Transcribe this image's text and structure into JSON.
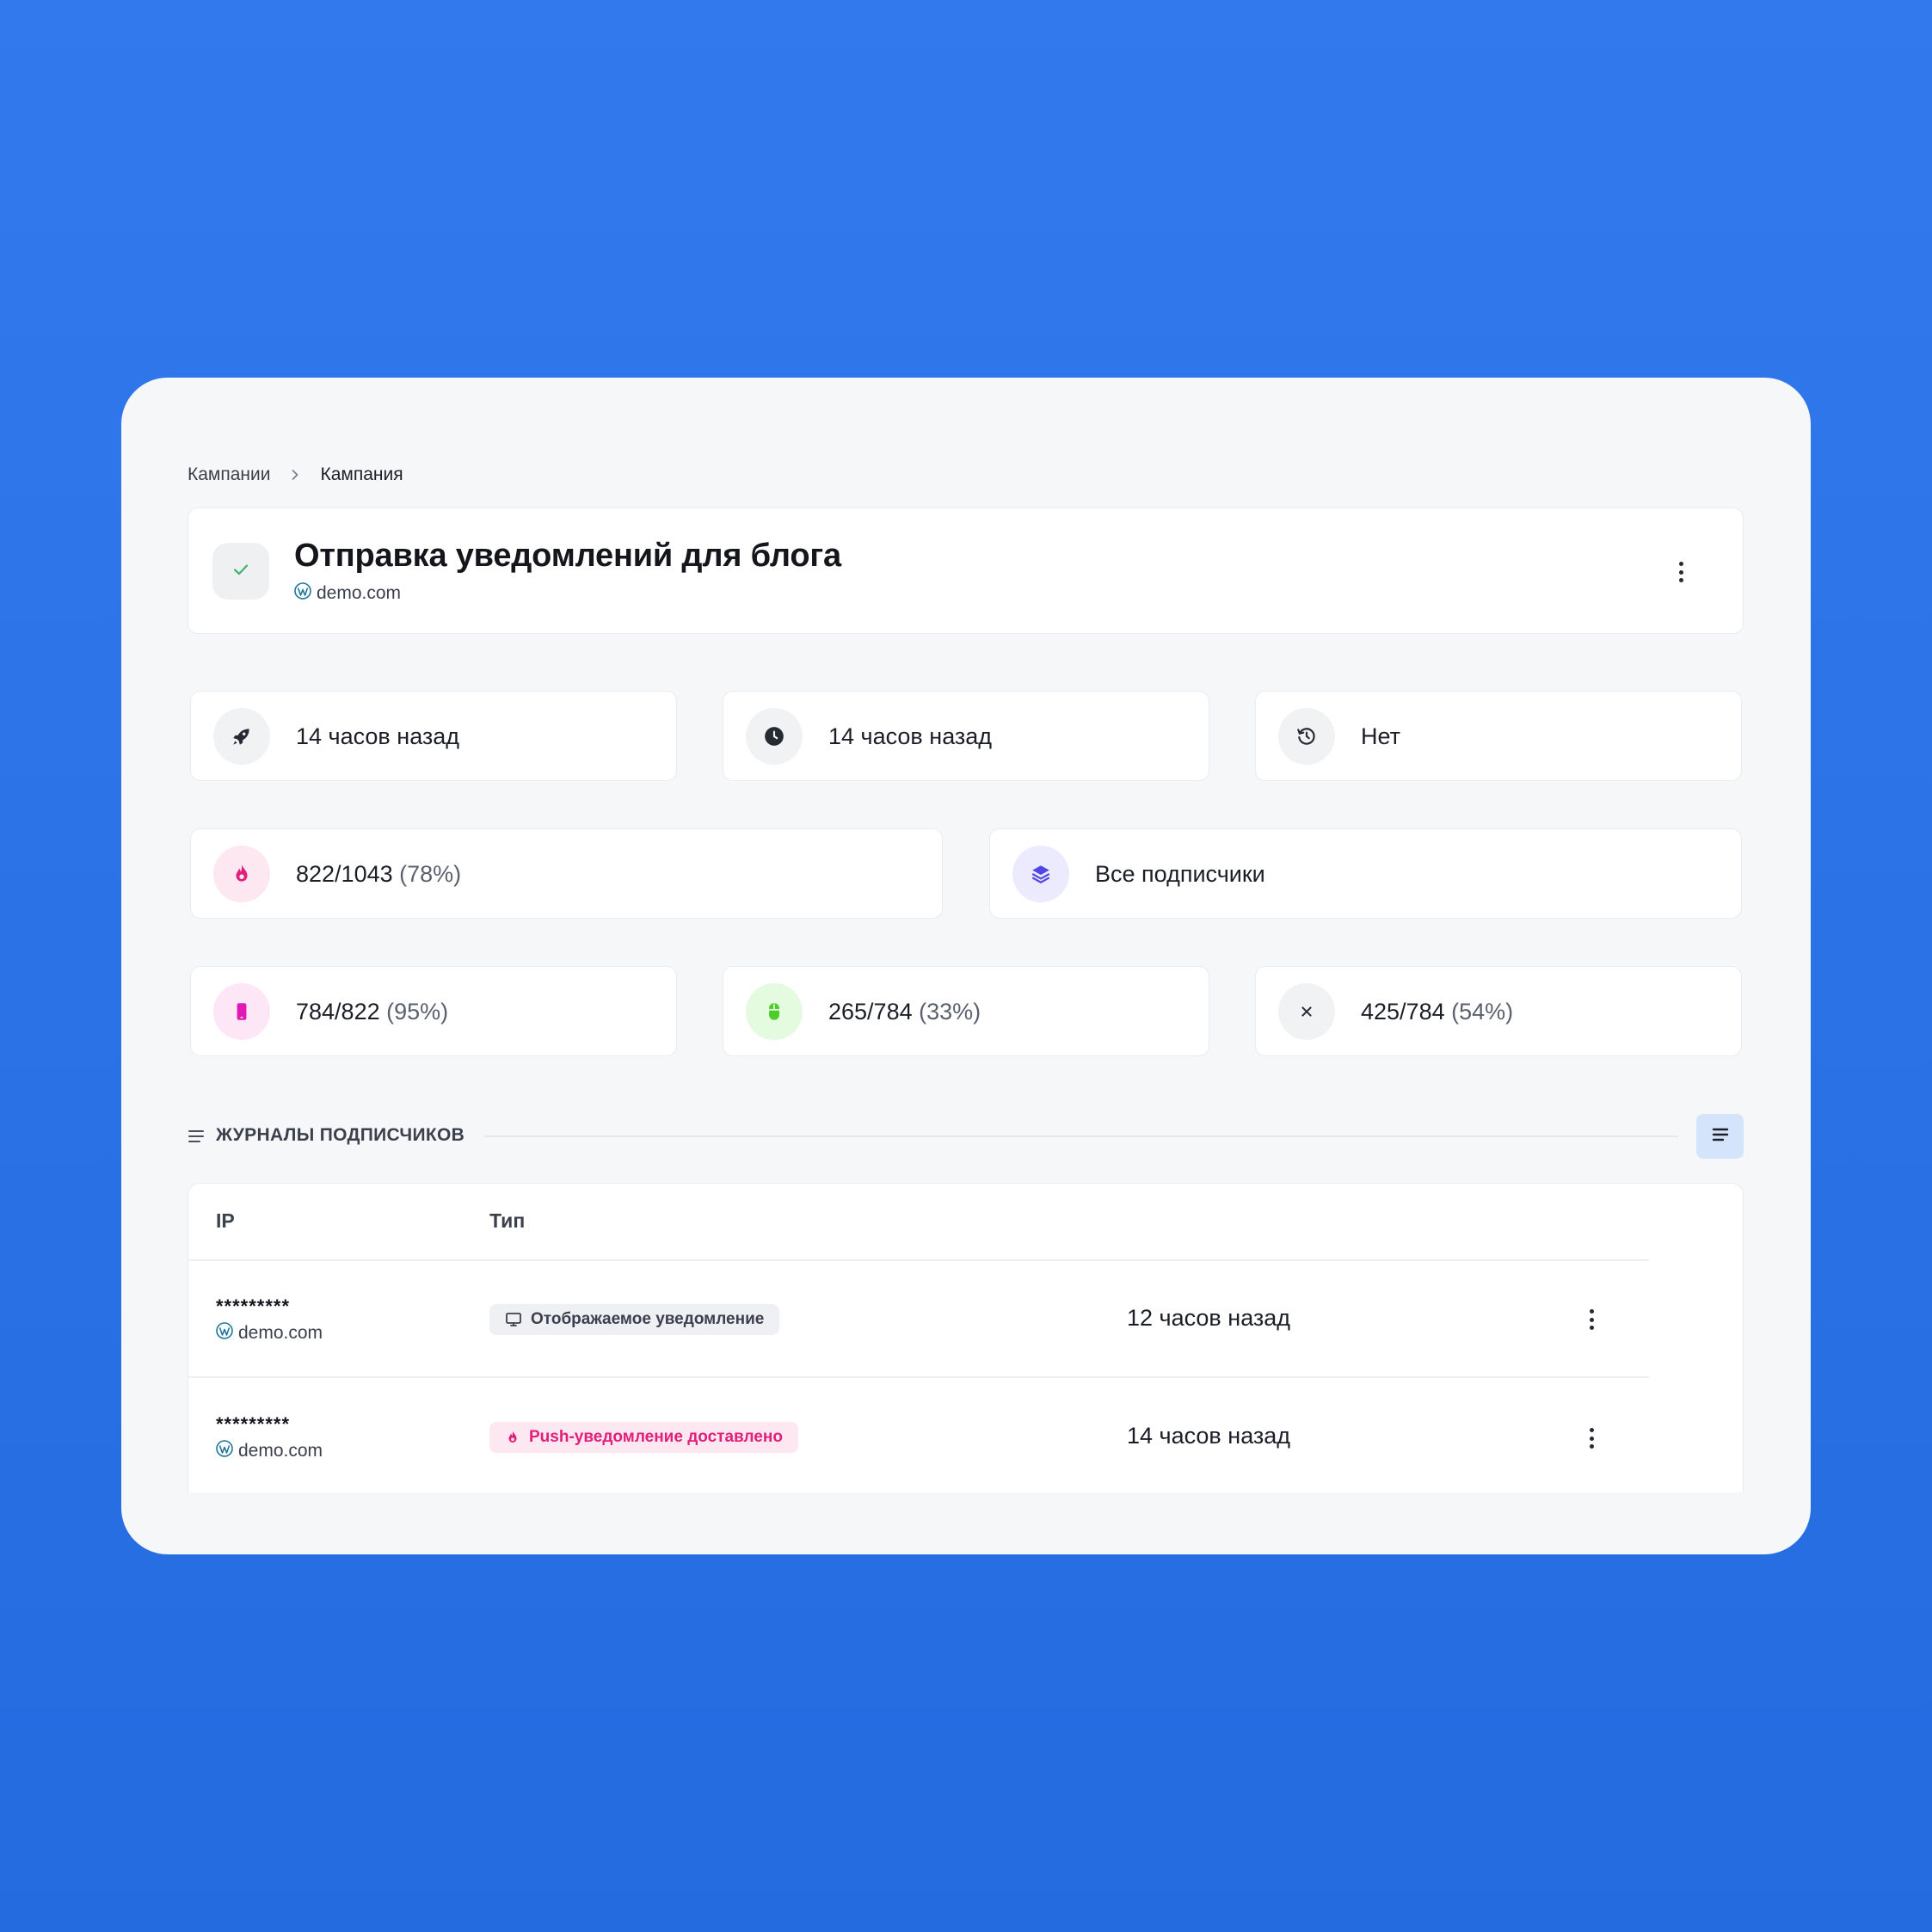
{
  "breadcrumb": {
    "parent": "Кампании",
    "current": "Кампания"
  },
  "campaign": {
    "title": "Отправка уведомлений для блога",
    "site": "demo.com",
    "status_icon": "check-icon"
  },
  "stats_row1": [
    {
      "icon": "rocket-icon",
      "text": "14 часов назад"
    },
    {
      "icon": "clock-icon",
      "text": "14 часов назад"
    },
    {
      "icon": "history-icon",
      "text": "Нет"
    }
  ],
  "stats_row2": [
    {
      "icon": "fire-icon",
      "value": "822/1043",
      "pct": "(78%)"
    },
    {
      "icon": "layers-icon",
      "text": "Все подписчики"
    }
  ],
  "stats_row3": [
    {
      "icon": "phone-icon",
      "value": "784/822",
      "pct": "(95%)"
    },
    {
      "icon": "mouse-icon",
      "value": "265/784",
      "pct": "(33%)"
    },
    {
      "icon": "close-icon",
      "value": "425/784",
      "pct": "(54%)"
    }
  ],
  "logs": {
    "heading": "ЖУРНАЛЫ ПОДПИСЧИКОВ",
    "columns": [
      "IP",
      "Тип"
    ],
    "rows": [
      {
        "ip": "*********",
        "site": "demo.com",
        "type": "Отображаемое уведомление",
        "type_style": "gray",
        "when": "12 часов назад"
      },
      {
        "ip": "*********",
        "site": "demo.com",
        "type": "Push-уведомление доставлено",
        "type_style": "pink",
        "when": "14 часов назад"
      }
    ]
  },
  "colors": {
    "background": "#2c74e8",
    "pink_accent": "#e0207a",
    "purple_accent": "#4f46e5",
    "green_accent": "#4ccd2b",
    "wp_blue": "#21759b"
  }
}
